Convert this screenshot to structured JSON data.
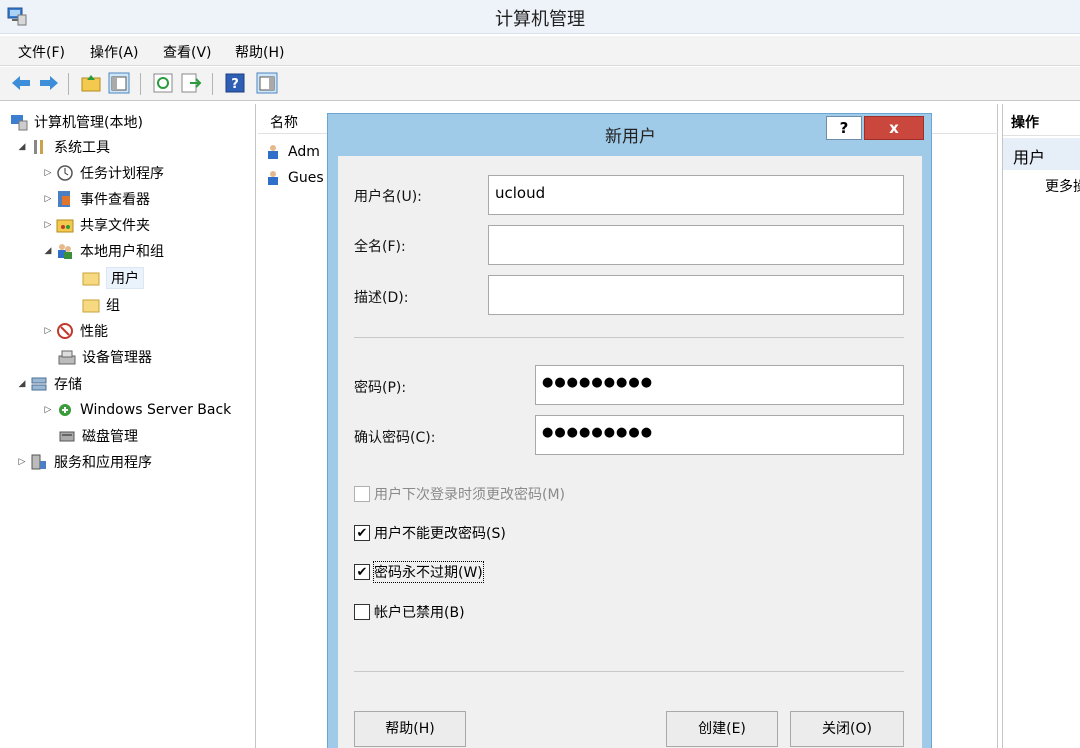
{
  "window": {
    "title": "计算机管理",
    "icon": "computer-management-icon"
  },
  "menubar": {
    "items": [
      "文件(F)",
      "操作(A)",
      "查看(V)",
      "帮助(H)"
    ]
  },
  "toolbar": {
    "buttons": [
      "back-icon",
      "forward-icon",
      "up-folder-icon",
      "show-hide-tree-icon",
      "refresh-icon",
      "export-list-icon",
      "help-icon",
      "show-hide-action-pane-icon"
    ]
  },
  "tree": {
    "items": [
      {
        "label": "计算机管理(本地)",
        "icon": "computer-management-icon"
      },
      {
        "label": "系统工具",
        "icon": "tools-icon"
      },
      {
        "label": "任务计划程序",
        "icon": "clock-icon"
      },
      {
        "label": "事件查看器",
        "icon": "event-viewer-icon"
      },
      {
        "label": "共享文件夹",
        "icon": "shared-folder-icon"
      },
      {
        "label": "本地用户和组",
        "icon": "users-icon"
      },
      {
        "label": "用户",
        "icon": "folder-icon"
      },
      {
        "label": "组",
        "icon": "folder-icon"
      },
      {
        "label": "性能",
        "icon": "performance-icon"
      },
      {
        "label": "设备管理器",
        "icon": "device-manager-icon"
      },
      {
        "label": "存储",
        "icon": "storage-icon"
      },
      {
        "label": "Windows Server Back",
        "icon": "backup-icon"
      },
      {
        "label": "磁盘管理",
        "icon": "disk-icon"
      },
      {
        "label": "服务和应用程序",
        "icon": "services-icon"
      }
    ]
  },
  "list": {
    "header": {
      "name_col": "名称"
    },
    "rows": [
      {
        "label": "Adm",
        "icon": "user-icon"
      },
      {
        "label": "Gues",
        "icon": "user-icon"
      }
    ]
  },
  "actions": {
    "header": "操作",
    "section": "用户",
    "more": "更多操"
  },
  "dialog": {
    "title": "新用户",
    "help_glyph": "?",
    "close_glyph": "x",
    "username_label": "用户名(U):",
    "username_value": "ucloud",
    "fullname_label": "全名(F):",
    "fullname_value": "",
    "description_label": "描述(D):",
    "description_value": "",
    "password_label": "密码(P):",
    "password_value": "●●●●●●●●●",
    "confirm_label": "确认密码(C):",
    "confirm_value": "●●●●●●●●●",
    "check_must_change": {
      "label": "用户下次登录时须更改密码(M)",
      "checked": false,
      "disabled": true
    },
    "check_cannot_change": {
      "label": "用户不能更改密码(S)",
      "checked": true
    },
    "check_never_expires": {
      "label": "密码永不过期(W)",
      "checked": true
    },
    "check_disabled": {
      "label": "帐户已禁用(B)",
      "checked": false
    },
    "check_glyph": "✔",
    "help_button": "帮助(H)",
    "create_button": "创建(E)",
    "close_button": "关闭(O)"
  }
}
